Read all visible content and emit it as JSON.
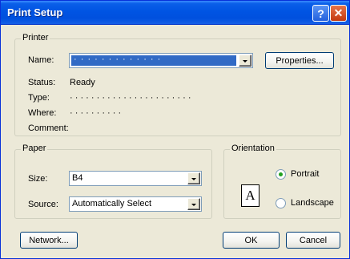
{
  "title": "Print Setup",
  "titlebar": {
    "help": "?",
    "close": "✕"
  },
  "printer": {
    "group_label": "Printer",
    "name_label": "Name:",
    "name_value": "· · · · · · · · · · · · ·",
    "properties_button": "Properties...",
    "status_label": "Status:",
    "status_value": "Ready",
    "type_label": "Type:",
    "type_value": "· · · · · · · · · · · · · · · · · · · · · · ·",
    "where_label": "Where:",
    "where_value": "· · · · · · · · · ·",
    "comment_label": "Comment:",
    "comment_value": ""
  },
  "paper": {
    "group_label": "Paper",
    "size_label": "Size:",
    "size_value": "B4",
    "source_label": "Source:",
    "source_value": "Automatically Select"
  },
  "orientation": {
    "group_label": "Orientation",
    "icon_letter": "A",
    "portrait_label": "Portrait",
    "landscape_label": "Landscape",
    "selected": "Portrait"
  },
  "buttons": {
    "network": "Network...",
    "ok": "OK",
    "cancel": "Cancel"
  },
  "colors": {
    "titlebar": "#0054e3",
    "dialog_bg": "#ece9d8",
    "selection": "#316ac5",
    "radio_dot": "#21a121"
  },
  "icons": [
    "help-icon",
    "close-icon",
    "dropdown-arrow-icon",
    "portrait-page-icon"
  ]
}
